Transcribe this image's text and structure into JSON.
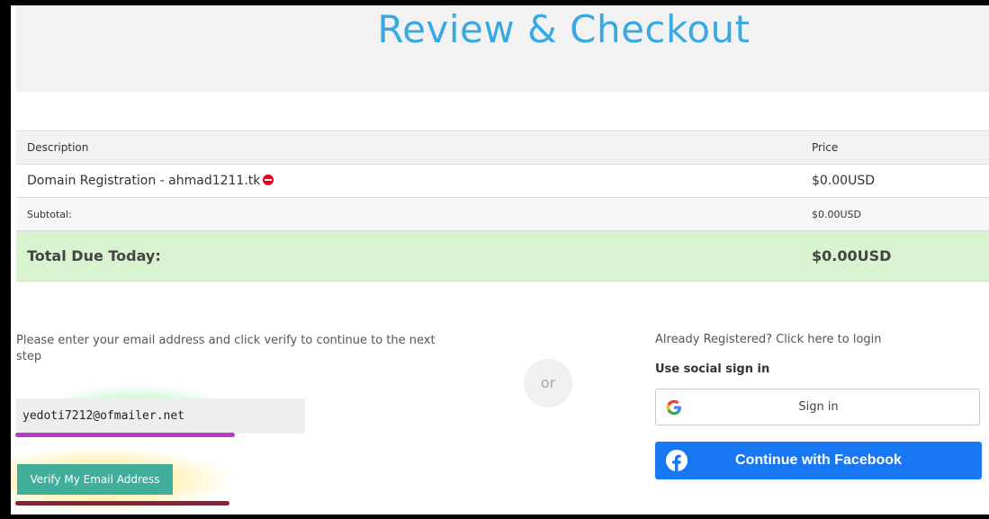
{
  "page": {
    "title": "Review & Checkout"
  },
  "order_summary": {
    "headers": {
      "description": "Description",
      "price": "Price"
    },
    "items": [
      {
        "description": "Domain Registration - ahmad1211.tk",
        "price": "$0.00USD",
        "icon": "remove-icon"
      }
    ],
    "subtotal": {
      "label": "Subtotal:",
      "value": "$0.00USD"
    },
    "total": {
      "label": "Total Due Today:",
      "value": "$0.00USD"
    }
  },
  "email_verification": {
    "instructions": "Please enter your email address and click verify to continue to the next step",
    "email_value": "yedoti7212@ofmailer.net",
    "verify_button_label": "Verify My Email Address"
  },
  "divider": {
    "label": "or"
  },
  "login": {
    "already_registered_text": "Already Registered? Click here to login",
    "social_label": "Use social sign in",
    "google_button_label": "Sign in",
    "facebook_button_label": "Continue with Facebook"
  },
  "colors": {
    "title": "#3aa9e0",
    "total_row_bg": "#d9f2d0",
    "verify_button_bg": "#3fae9a",
    "facebook_blue": "#1877f2",
    "remove_icon": "#e8001c",
    "annotation_purple": "#b73dc8",
    "annotation_maroon": "#8e1f34"
  }
}
